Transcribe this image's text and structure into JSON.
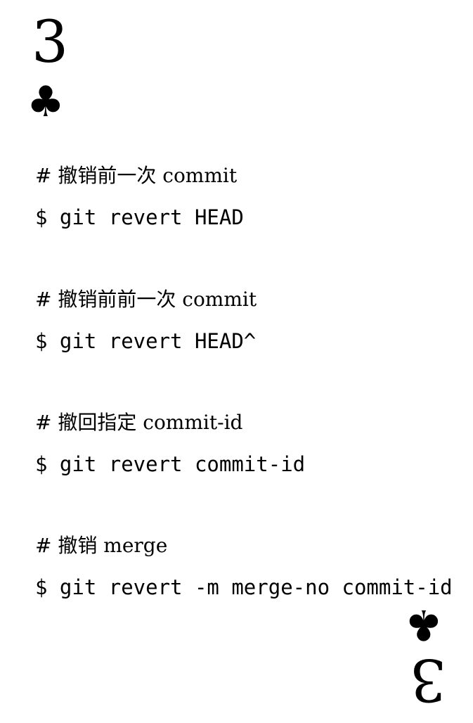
{
  "card": {
    "rank": "3",
    "suit_symbol": "♣",
    "suit_icon": "club-icon"
  },
  "snippets": [
    {
      "comment": "# 撤销前一次 commit",
      "command": "$ git revert HEAD"
    },
    {
      "comment": "# 撤销前前一次 commit",
      "command": "$ git revert HEAD^"
    },
    {
      "comment": "# 撤回指定 commit-id",
      "command": "$ git revert commit-id"
    },
    {
      "comment": "# 撤销 merge",
      "command": "$ git revert -m merge-no commit-id"
    }
  ]
}
